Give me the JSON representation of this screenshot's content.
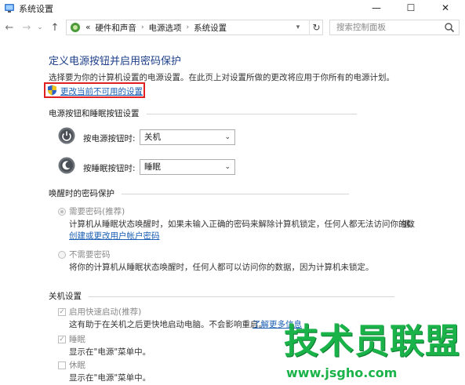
{
  "window": {
    "title": "系统设置",
    "minimize": "—",
    "maximize": "☐",
    "close": "✕"
  },
  "nav": {
    "back": "←",
    "forward": "→",
    "recent": "⌄",
    "up": "↑",
    "breadcrumb_prefix": "«",
    "breadcrumbs": [
      "硬件和声音",
      "电源选项",
      "系统设置"
    ],
    "separator": "›",
    "refresh": "↻",
    "search_placeholder": "搜索控制面板"
  },
  "main": {
    "title": "定义电源按钮并启用密码保护",
    "description": "选择要为你的计算机设置的电源设置。在此页上对设置所做的更改将应用于你所有的电源计划。",
    "unlock_link": "更改当前不可用的设置"
  },
  "power_buttons": {
    "section_title": "电源按钮和睡眠按钮设置",
    "power_label": "按电源按钮时:",
    "power_value": "关机",
    "sleep_label": "按睡眠按钮时:",
    "sleep_value": "睡眠"
  },
  "password": {
    "section_title": "唤醒时的密码保护",
    "require_label": "需要密码(推荐)",
    "require_desc_1": "计算机从睡眠状态唤醒时，如果未输入正确的密码来解除计算机锁定，任何人都无法访问你的数",
    "require_desc_2": "据。",
    "create_link": "创建或更改用户帐户密码",
    "norequire_label": "不需要密码",
    "norequire_desc": "将你的计算机从睡眠状态唤醒时，任何人都可以访问你的数据，因为计算机未锁定。"
  },
  "shutdown": {
    "section_title": "关机设置",
    "fast_label": "启用快速启动(推荐)",
    "fast_desc": "这有助于在关机之后更快地启动电脑。不会影响重启。",
    "learn_more": "了解更多信息",
    "sleep_label": "睡眠",
    "sleep_desc": "显示在\"电源\"菜单中。",
    "hibernate_label": "休眠",
    "hibernate_desc": "显示在\"电源\"菜单中。"
  },
  "watermark": {
    "text": "技术员联盟",
    "url": "www.jsgho.com"
  },
  "colors": {
    "heading": "#1e3f8a",
    "link": "#1a5fb4",
    "highlight": "#e02020",
    "watermark": "#1ab34a"
  }
}
